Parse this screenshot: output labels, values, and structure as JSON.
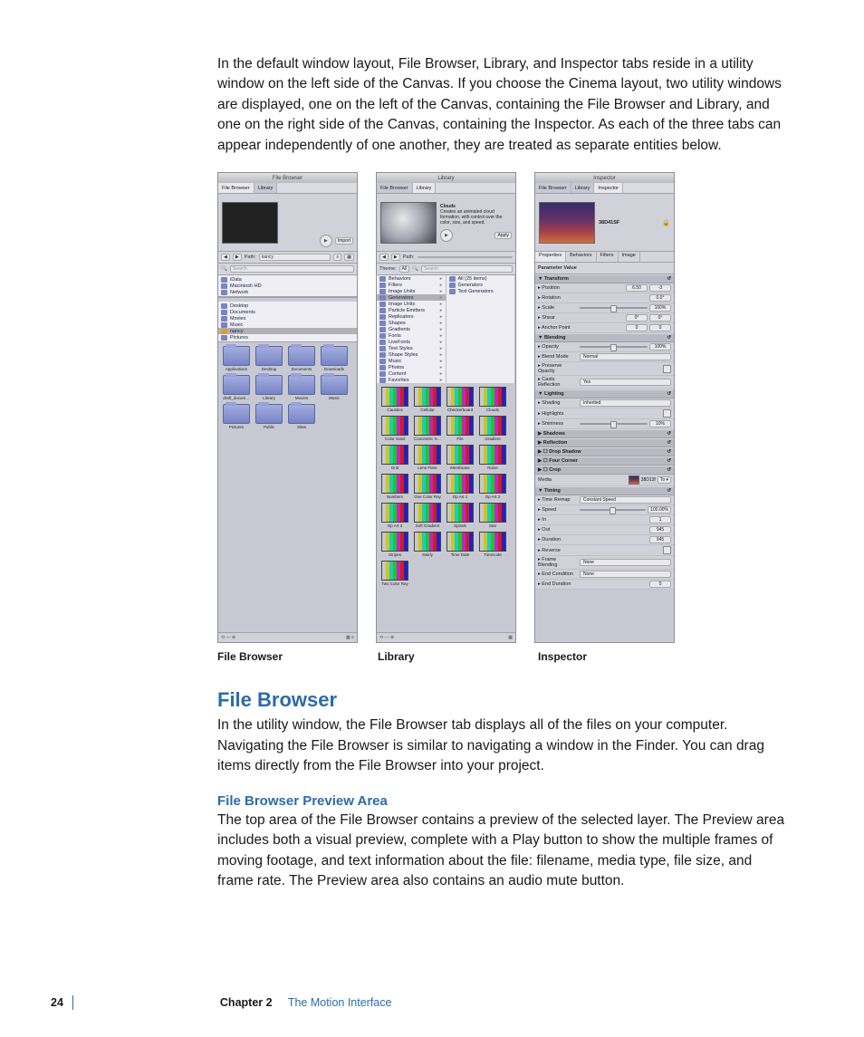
{
  "intro_paragraph": "In the default window layout, File Browser, Library, and Inspector tabs reside in a utility window on the left side of the Canvas. If you choose the Cinema layout, two utility windows are displayed, one on the left of the Canvas, containing the File Browser and Library, and one on the right side of the Canvas, containing the Inspector. As each of the three tabs can appear independently of one another, they are treated as separate entities below.",
  "captions": {
    "file_browser": "File Browser",
    "library": "Library",
    "inspector": "Inspector"
  },
  "section": {
    "title": "File Browser",
    "para": "In the utility window, the File Browser tab displays all of the files on your computer. Navigating the File Browser is similar to navigating a window in the Finder. You can drag items directly from the File Browser into your project.",
    "sub_title": "File Browser Preview Area",
    "sub_para": "The top area of the File Browser contains a preview of the selected layer. The Preview area includes both a visual preview, complete with a Play button to show the multiple frames of moving footage, and text information about the file: filename, media type, file size, and frame rate. The Preview area also contains an audio mute button."
  },
  "footer": {
    "page": "24",
    "chapter": "Chapter 2",
    "chapter_name": "The Motion Interface"
  },
  "fb": {
    "title": "File Browser",
    "tabs": [
      "File Browser",
      "Library"
    ],
    "import": "Import",
    "path_label": "Path:",
    "path_value": "nancy",
    "search_placeholder": "Search",
    "sidebar": [
      "iData",
      "Macintosh HD",
      "Network",
      "Desktop",
      "Documents",
      "Movies",
      "Music",
      "nancy",
      "Pictures"
    ],
    "warn_item": "nancy",
    "folders": [
      "Applications",
      "Desktop",
      "Documents",
      "Downloads",
      "draft_docum…",
      "Library",
      "Movies",
      "Music",
      "Pictures",
      "Public",
      "Sites"
    ]
  },
  "lib": {
    "title": "Library",
    "tabs": [
      "File Browser",
      "Library"
    ],
    "desc_title": "Clouds",
    "desc_text": "Creates an animated cloud formation, with control over the color, size, and speed.",
    "apply": "Apply",
    "path_label": "Path:",
    "theme_label": "Theme:",
    "theme_value": "All",
    "search_placeholder": "Search",
    "left_list": [
      "Behaviors",
      "Filters",
      "Image Units",
      "Generators",
      "Image Units",
      "Particle Emitters",
      "Replicators",
      "Shapes",
      "Gradients",
      "Fonts",
      "LiveFonts",
      "Text Styles",
      "Shape Styles",
      "Music",
      "Photos",
      "Content",
      "Favorites"
    ],
    "left_selected": "Generators",
    "right_list": [
      "All (25 items)",
      "Generators",
      "Text Generators"
    ],
    "thumbs": [
      "Caustics",
      "Cellular",
      "Checkerboard",
      "Clouds",
      "Color Solid",
      "Concentric S…",
      "File",
      "Gradient",
      "Grid",
      "Lens Flare",
      "Membrane",
      "Noise",
      "Numbers",
      "One Color Ray",
      "Op Art 1",
      "Op Art 2",
      "Op Art 3",
      "Soft Gradient",
      "Spirals",
      "Star",
      "Stripes",
      "Swirly",
      "Time Date",
      "Timecode",
      "Two Color Ray"
    ]
  },
  "insp": {
    "title": "Inspector",
    "tabs": [
      "File Browser",
      "Library",
      "Inspector"
    ],
    "clip_name": "38D41SF",
    "subtabs": [
      "Properties",
      "Behaviors",
      "Filters",
      "Image"
    ],
    "columns": "Parameter          Value",
    "transform": {
      "head": "Transform",
      "rows": [
        {
          "label": "Position",
          "vals": [
            "6.50",
            "-3"
          ]
        },
        {
          "label": "Rotation",
          "vals": [
            "0.0°"
          ]
        },
        {
          "label": "Scale",
          "vals": [
            "100%"
          ]
        },
        {
          "label": "Shear",
          "vals": [
            "0°",
            "0°"
          ]
        },
        {
          "label": "Anchor Point",
          "vals": [
            "0",
            "0"
          ]
        }
      ]
    },
    "blending": {
      "head": "Blending",
      "rows": [
        {
          "label": "Opacity",
          "vals": [
            "100%"
          ]
        },
        {
          "label": "Blend Mode",
          "drop": "Normal"
        },
        {
          "label": "Preserve Opacity",
          "check": true
        },
        {
          "label": "Casts Reflection",
          "drop": "Yes"
        }
      ]
    },
    "lighting": {
      "head": "Lighting",
      "rows": [
        {
          "label": "Shading",
          "drop": "Inherited"
        },
        {
          "label": "Highlights",
          "check": true
        },
        {
          "label": "Shininess",
          "vals": [
            "10%"
          ]
        }
      ]
    },
    "collapsed": [
      "Shadows",
      "Reflection",
      "Drop Shadow",
      "Four Corner",
      "Crop"
    ],
    "media": {
      "label": "Media",
      "name": "38D13f",
      "btn": "To"
    },
    "timing": {
      "head": "Timing",
      "rows": [
        {
          "label": "Time Remap",
          "drop": "Constant Speed"
        },
        {
          "label": "Speed",
          "vals": [
            "100.00%"
          ]
        },
        {
          "label": "In",
          "vals": [
            "1"
          ]
        },
        {
          "label": "Out",
          "vals": [
            "945"
          ]
        },
        {
          "label": "Duration",
          "vals": [
            "945"
          ]
        },
        {
          "label": "Reverse",
          "check": true
        },
        {
          "label": "Frame Blending",
          "drop": "None"
        },
        {
          "label": "End Condition",
          "drop": "None"
        },
        {
          "label": "End Duration",
          "vals": [
            "0"
          ]
        }
      ]
    }
  }
}
